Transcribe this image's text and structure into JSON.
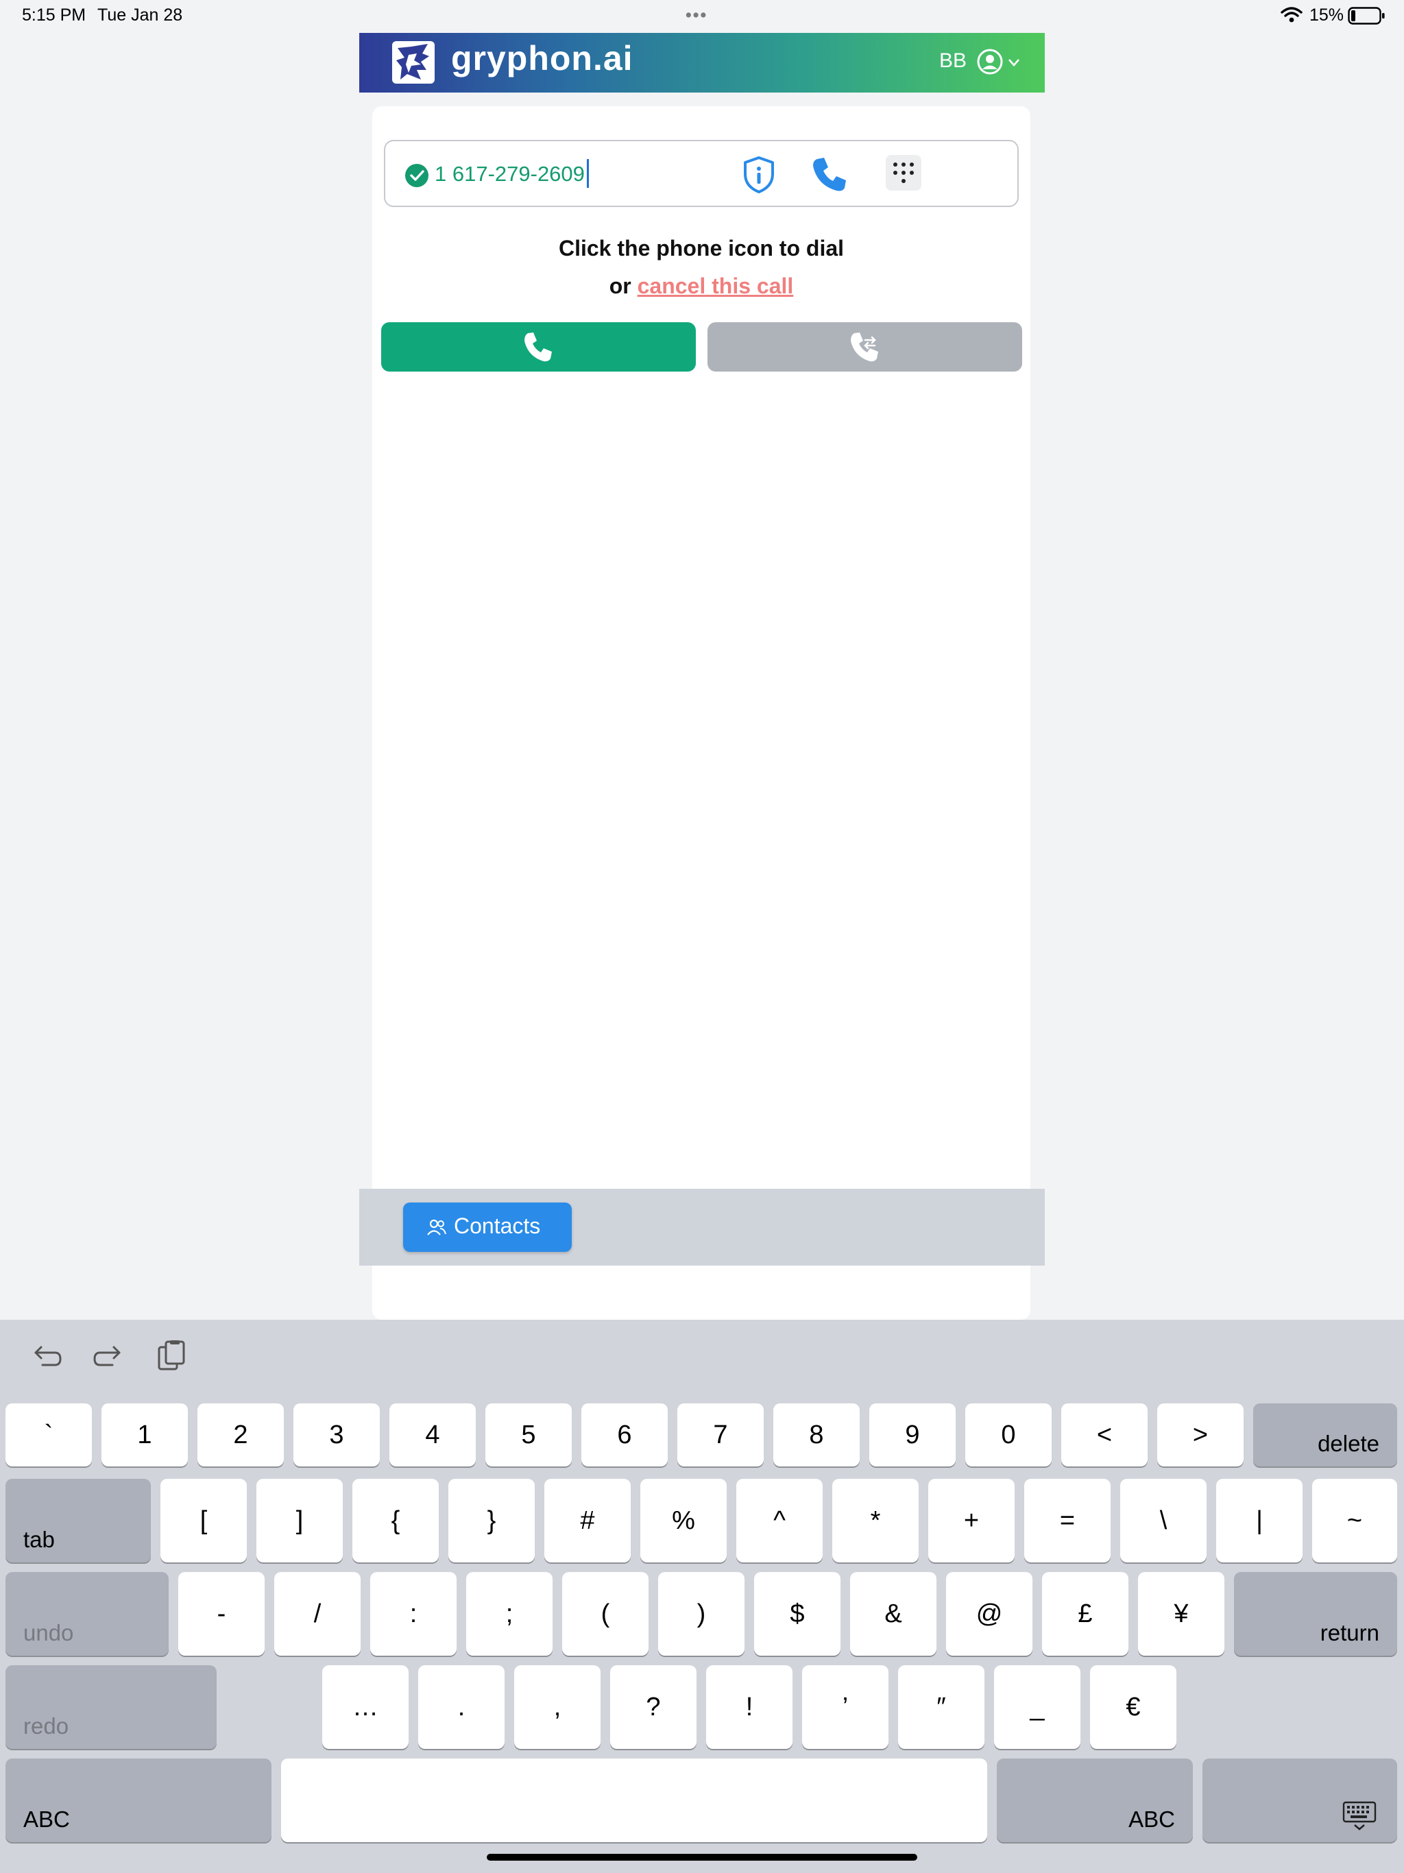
{
  "status_bar": {
    "time": "5:15 PM",
    "date": "Tue Jan 28",
    "more": "•••",
    "battery": "15%"
  },
  "header": {
    "brand": "gryphon.ai",
    "user_initials": "BB"
  },
  "dialer": {
    "phone_number": "1 617-279-2609",
    "instruction": "Click the phone icon to dial",
    "or_text": "or",
    "cancel_link": "cancel this call"
  },
  "footer": {
    "contacts_label": "Contacts"
  },
  "colors": {
    "call_green": "#10a87a",
    "accent_blue": "#2a8be8",
    "cancel_red": "#f07f7f",
    "valid_green": "#149b6f"
  },
  "keyboard": {
    "row1": [
      "`",
      "1",
      "2",
      "3",
      "4",
      "5",
      "6",
      "7",
      "8",
      "9",
      "0",
      "<",
      ">"
    ],
    "delete": "delete",
    "tab": "tab",
    "row2": [
      "[",
      "]",
      "{",
      "}",
      "#",
      "%",
      "^",
      "*",
      "+",
      "=",
      "\\",
      "|",
      "~"
    ],
    "undo": "undo",
    "row3": [
      "-",
      "/",
      ":",
      ";",
      "(",
      ")",
      "$",
      "&",
      "@",
      "£",
      "¥"
    ],
    "return": "return",
    "redo": "redo",
    "row4": [
      "…",
      ".",
      ",",
      "?",
      "!",
      "’",
      "″",
      "_",
      "€"
    ],
    "abc_left": "ABC",
    "abc_right": "ABC"
  }
}
